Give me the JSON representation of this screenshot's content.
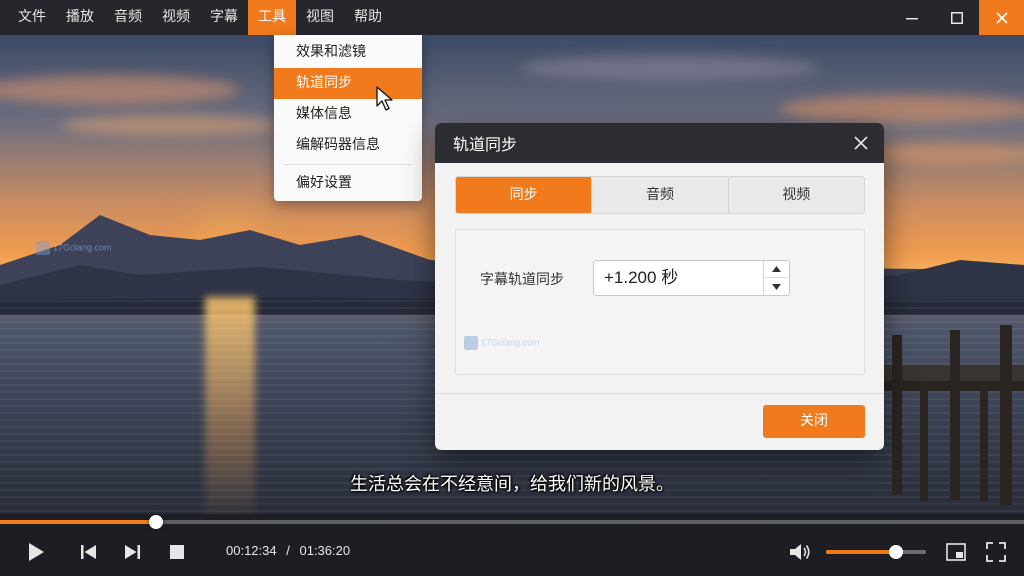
{
  "menubar": {
    "items": [
      "文件",
      "播放",
      "音频",
      "视频",
      "字幕",
      "工具",
      "视图",
      "帮助"
    ],
    "active": "工具"
  },
  "window_controls": [
    "minimize-icon",
    "maximize-icon",
    "close-icon"
  ],
  "tools_menu": {
    "items": [
      "效果和滤镜",
      "轨道同步",
      "媒体信息",
      "编解码器信息",
      "偏好设置"
    ],
    "active": "轨道同步"
  },
  "dialog": {
    "title": "轨道同步",
    "tabs": [
      "同步",
      "音频",
      "视频"
    ],
    "active_tab": "同步",
    "field_label": "字幕轨道同步",
    "field_value": "+1.200 秒",
    "close_button": "关闭"
  },
  "watermark": "17Golang.com",
  "subtitle": "生活总会在不经意间，给我们新的风景。",
  "player": {
    "current_time": "00:12:34",
    "time_separator": "/",
    "total_time": "01:36:20",
    "progress_fraction": 0.152,
    "volume_fraction": 0.7
  },
  "colors": {
    "accent": "#f07a1c",
    "menubar": "#25272c",
    "dialog_header": "#2b2d32"
  }
}
